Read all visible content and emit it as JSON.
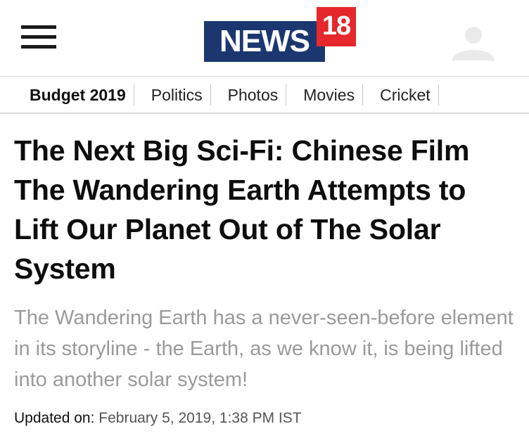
{
  "header": {
    "menu_icon": "hamburger-menu-icon",
    "logo": {
      "word": "NEWS",
      "number": "18",
      "colors": {
        "word_bg": "#1c3770",
        "number_bg": "#e4282b",
        "text": "#ffffff"
      }
    }
  },
  "nav": {
    "items": [
      {
        "label": "Budget 2019",
        "active": true
      },
      {
        "label": "Politics"
      },
      {
        "label": "Photos"
      },
      {
        "label": "Movies"
      },
      {
        "label": "Cricket"
      }
    ]
  },
  "article": {
    "headline": "The Next Big Sci-Fi: Chinese Film The Wandering Earth Attempts to Lift Our Planet Out of The Solar System",
    "summary": "The Wandering Earth has a never-seen-before element in its storyline - the Earth, as we know it, is being lifted into another solar system!",
    "updated_label": "Updated on:",
    "updated_value": "February 5, 2019, 1:38 PM IST"
  }
}
